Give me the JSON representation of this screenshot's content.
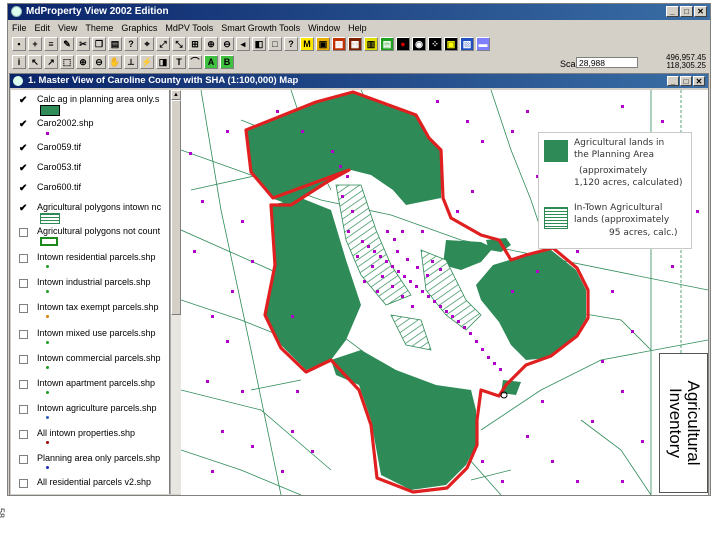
{
  "window": {
    "title": "MdProperty View 2002 Edition"
  },
  "menu": [
    "File",
    "Edit",
    "View",
    "Theme",
    "Graphics",
    "MdPV Tools",
    "Smart Growth Tools",
    "Window",
    "Help"
  ],
  "scale": {
    "label": "Scale 1:",
    "value": "28,988"
  },
  "coords": {
    "x": "496,957.45",
    "y": "118,305.25"
  },
  "map_window": {
    "title": "1. Master View of Caroline County with SHA (1:100,000)  Map"
  },
  "layers": [
    {
      "name": "Calc ag in planning area only.s",
      "checked": true
    },
    {
      "name": "Caro2002.shp",
      "checked": true
    },
    {
      "name": "Caro059.tif",
      "checked": true
    },
    {
      "name": "Caro053.tif",
      "checked": true
    },
    {
      "name": "Caro600.tif",
      "checked": true
    },
    {
      "name": "Agricultural polygons intown nc",
      "checked": true
    },
    {
      "name": "Agricultural polygons not count",
      "checked": false
    },
    {
      "name": "Intown residential parcels.shp",
      "checked": false
    },
    {
      "name": "Intown industrial parcels.shp",
      "checked": false
    },
    {
      "name": "Intown tax exempt parcels.shp",
      "checked": false
    },
    {
      "name": "Intown mixed use parcels.shp",
      "checked": false
    },
    {
      "name": "Intown commercial parcels.shp",
      "checked": false
    },
    {
      "name": "Intown apartment parcels.shp",
      "checked": false
    },
    {
      "name": "Intown agriculture parcels.shp",
      "checked": false
    },
    {
      "name": "All intown properties.shp",
      "checked": false
    },
    {
      "name": "Planning area only parcels.shp",
      "checked": false
    },
    {
      "name": "All residential parcels v2.shp",
      "checked": false
    }
  ],
  "legend": {
    "item1_line1": "Agricultural lands in",
    "item1_line2": "the Planning Area",
    "item1_line3": "(approximately",
    "item1_line4": "1,120 acres, calculated)",
    "item2_line1": "In-Town Agricultural",
    "item2_line2": "lands (approximately",
    "item2_line3": "95 acres, calc.)"
  },
  "overlay_label": {
    "line1": "Agricultural",
    "line2": "Inventory"
  },
  "page_number": "58",
  "colors": {
    "titlebar": "#0a246a",
    "ag_green": "#2e8b57",
    "boundary_red": "#e02020",
    "parcel_magenta": "#b000c8"
  }
}
